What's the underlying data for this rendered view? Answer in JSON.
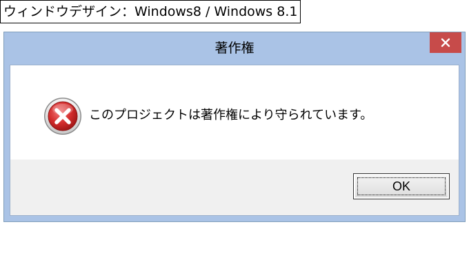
{
  "caption": "ウィンドウデザイン：Windows8 / Windows 8.1",
  "dialog": {
    "title": "著作権",
    "close_glyph": "✕",
    "icon": "error-icon",
    "message": "このプロジェクトは著作権により守られています。",
    "ok_label": "OK"
  },
  "colors": {
    "frame": "#aac3e6",
    "close_button": "#c74b4a",
    "footer": "#f0f0f0",
    "error_red": "#c8252c"
  }
}
